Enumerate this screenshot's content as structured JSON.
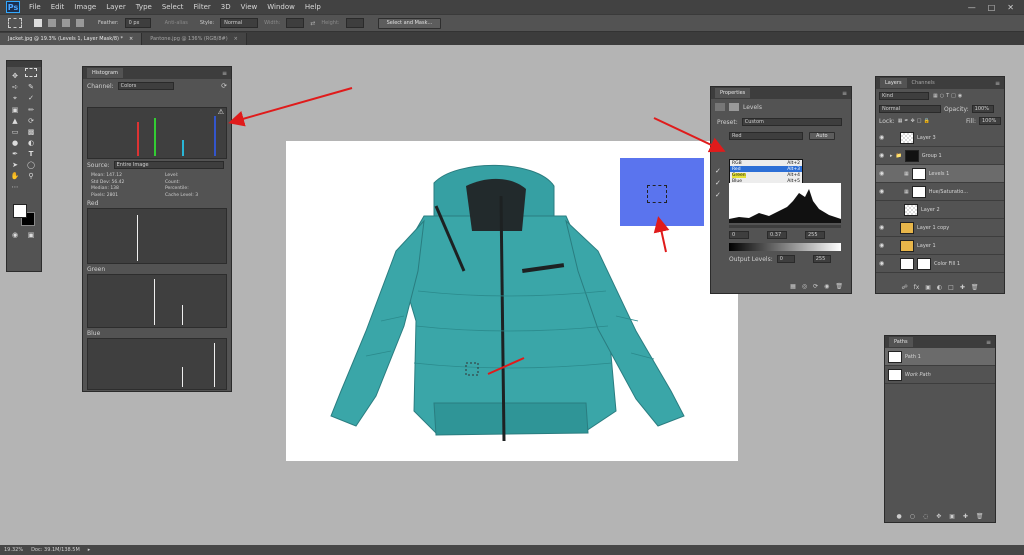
{
  "menubar": {
    "logo": "Ps",
    "items": [
      "File",
      "Edit",
      "Image",
      "Layer",
      "Type",
      "Select",
      "Filter",
      "3D",
      "View",
      "Window",
      "Help"
    ]
  },
  "options": {
    "feather_label": "Feather:",
    "feather_value": "0 px",
    "antialias_label": "Anti-alias",
    "style_label": "Style:",
    "style_value": "Normal",
    "width_label": "Width:",
    "height_label": "Height:",
    "select_mask_button": "Select and Mask..."
  },
  "tabs": [
    {
      "label": "Jacket.jpg @ 19.3% (Levels 1, Layer Mask/8) *"
    },
    {
      "label": "Pantone.jpg @ 136% (RGB/8#)"
    }
  ],
  "histogram": {
    "title": "Histogram",
    "channel_label": "Channel:",
    "channel_value": "Colors",
    "source_label": "Source:",
    "source_value": "Entire Image",
    "stats_left": [
      "Mean: 147.12",
      "Std Dev: 56.42",
      "Median: 138",
      "Pixels: 2801"
    ],
    "stats_right": [
      "Level:",
      "Count:",
      "Percentile:",
      "Cache Level: 3"
    ],
    "red_label": "Red",
    "green_label": "Green",
    "blue_label": "Blue"
  },
  "properties": {
    "title": "Properties",
    "adjustment_name": "Levels",
    "preset_label": "Preset:",
    "preset_value": "Custom",
    "channel_value": "Red",
    "auto_button": "Auto",
    "channel_options": [
      {
        "name": "RGB",
        "shortcut": "Alt+2"
      },
      {
        "name": "Red",
        "shortcut": "Alt+3"
      },
      {
        "name": "Green",
        "shortcut": "Alt+4"
      },
      {
        "name": "Blue",
        "shortcut": "Alt+5"
      }
    ],
    "input_black": "0",
    "input_gamma": "0.37",
    "input_white": "255",
    "output_label": "Output Levels:",
    "output_black": "0",
    "output_white": "255"
  },
  "layers": {
    "tab_layers": "Layers",
    "tab_channels": "Channels",
    "kind_value": "Kind",
    "blend_value": "Normal",
    "opacity_label": "Opacity:",
    "opacity_value": "100%",
    "lock_label": "Lock:",
    "fill_label": "Fill:",
    "fill_value": "100%",
    "rows": [
      {
        "name": "Layer 3"
      },
      {
        "name": "Group 1"
      },
      {
        "name": "Levels 1"
      },
      {
        "name": "Hue/Saturatio..."
      },
      {
        "name": "Layer 2"
      },
      {
        "name": "Layer 1 copy"
      },
      {
        "name": "Layer 1"
      },
      {
        "name": "Color Fill 1"
      }
    ]
  },
  "paths": {
    "title": "Paths",
    "rows": [
      {
        "name": "Path 1"
      },
      {
        "name": "Work Path"
      }
    ]
  },
  "status": {
    "zoom": "19.32%",
    "doc": "Doc: 39.1M/138.5M"
  },
  "colors": {
    "accent_blue": "#2d6fd6",
    "swatch_blue": "#5a74ee",
    "jacket_teal": "#3aa6a8",
    "arrow_red": "#e01b1b"
  }
}
